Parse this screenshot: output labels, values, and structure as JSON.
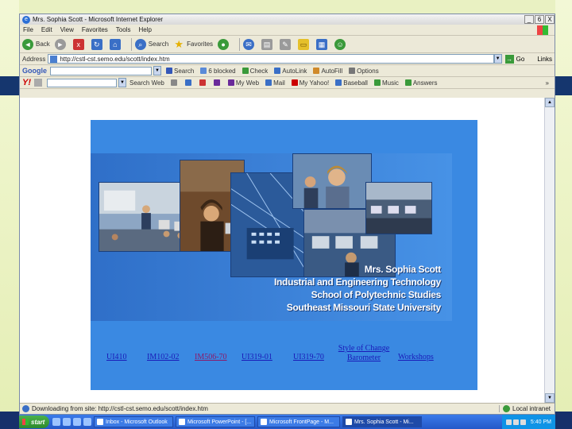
{
  "window": {
    "title": "Mrs. Sophia Scott - Microsoft Internet Explorer",
    "controls": [
      "_",
      "6",
      "X"
    ]
  },
  "menu": [
    "File",
    "Edit",
    "View",
    "Favorites",
    "Tools",
    "Help"
  ],
  "toolbar": {
    "back": "Back",
    "search": "Search",
    "favorites": "Favorites"
  },
  "address": {
    "label": "Address",
    "url": "http://cstl-cst.semo.edu/scott/index.htm",
    "go": "Go",
    "links": "Links"
  },
  "google_bar": {
    "logo": "Google",
    "search_btn": "Search",
    "blocked": "6 blocked",
    "check": "Check",
    "autolink": "AutoLink",
    "autofill": "AutoFill",
    "options": "Options"
  },
  "yahoo_bar": {
    "logo": "Y!",
    "search_web": "Search Web",
    "my_web": "My Web",
    "mail": "Mail",
    "my_yahoo": "My Yahoo!",
    "baseball": "Baseball",
    "music": "Music",
    "answers": "Answers"
  },
  "banner": {
    "line1": "Mrs. Sophia Scott",
    "line2": "Industrial and Engineering Technology",
    "line3": "School of Polytechnic Studies",
    "line4": "Southeast Missouri State University"
  },
  "course_links": [
    {
      "label": "UI410"
    },
    {
      "label": "IM102-02"
    },
    {
      "label": "IM506-70"
    },
    {
      "label": "UI319-01"
    },
    {
      "label": "UI319-70"
    },
    {
      "label": "Style of Change Barometer"
    },
    {
      "label": "Workshops"
    }
  ],
  "status": {
    "text": "Downloading from site: http://cstl-cst.semo.edu/scott/index.htm",
    "zone": "Local intranet"
  },
  "taskbar": {
    "start": "start",
    "tasks": [
      "Inbox - Microsoft Outlook",
      "Microsoft PowerPoint - [...",
      "Microsoft FrontPage - M...",
      "Mrs. Sophia Scott - Mi..."
    ],
    "time": "5:40 PM"
  }
}
